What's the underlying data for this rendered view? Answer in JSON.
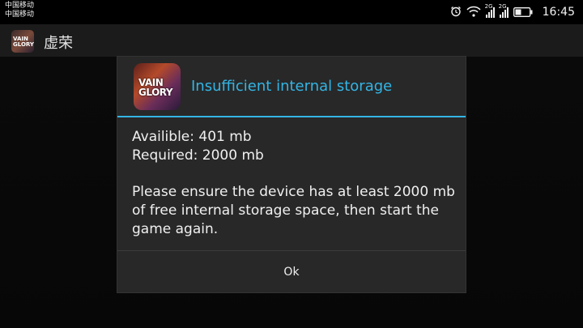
{
  "status_bar": {
    "carrier_1": "中国移动",
    "carrier_2": "中国移动",
    "sim1_label": "2G",
    "sim2_label": "2G",
    "time": "16:45",
    "icons": [
      "alarm-icon",
      "wifi-icon",
      "signal-icon",
      "signal-icon",
      "battery-icon"
    ]
  },
  "app_bar": {
    "title": "虚荣",
    "icon_text": "VAIN GLORY"
  },
  "dialog": {
    "icon_text_1": "VAIN",
    "icon_text_2": "GLORY",
    "title": "Insufficient internal storage",
    "available": "Availible: 401 mb",
    "required": "Required: 2000 mb",
    "message": "Please ensure the device has at least 2000 mb of free internal storage space, then start the game again.",
    "ok_label": "Ok"
  },
  "colors": {
    "accent": "#33b5e5",
    "dialog_bg": "#282828",
    "action_bar_bg": "#1b1b1b"
  }
}
